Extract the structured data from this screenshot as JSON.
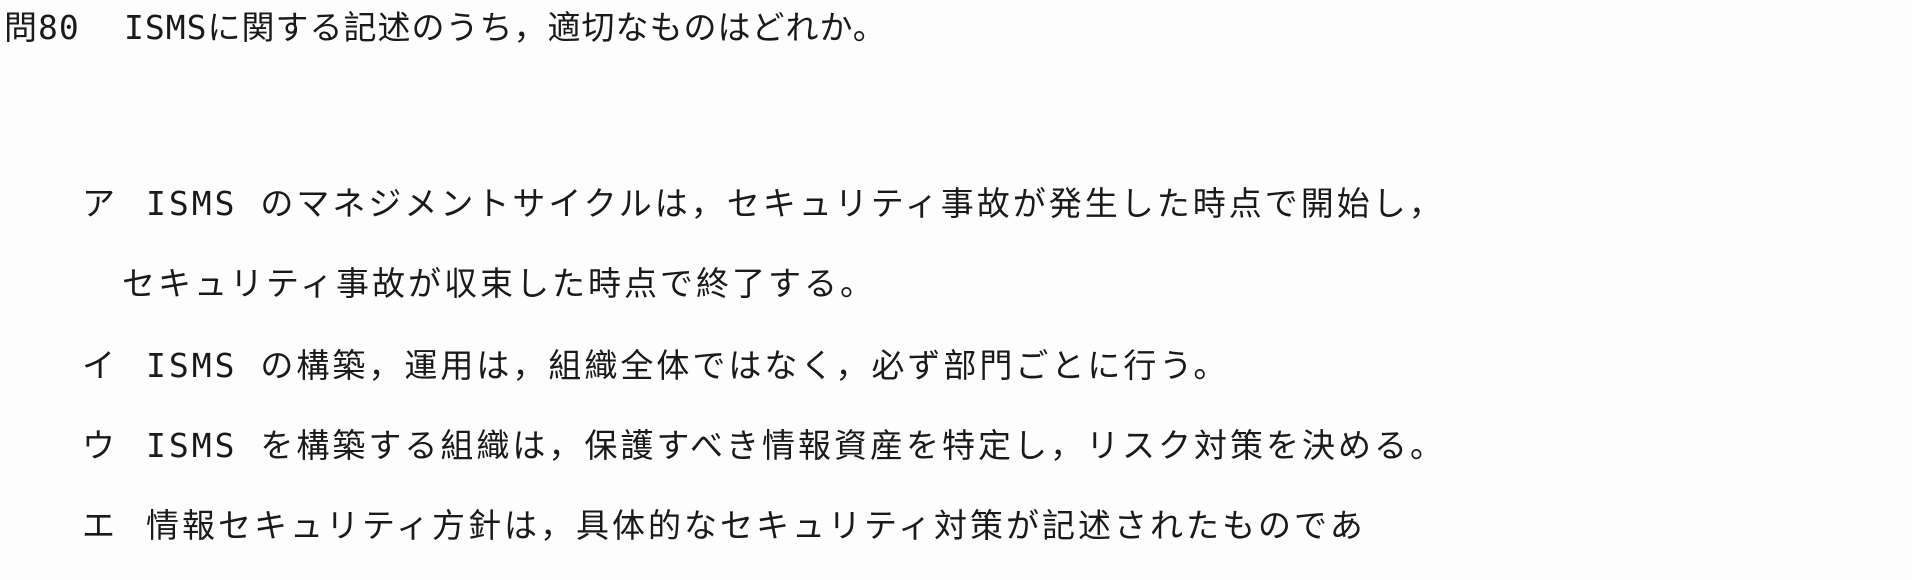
{
  "question": {
    "number": "問80",
    "text": "ISMSに関する記述のうち，適切なものはどれか。"
  },
  "choices": [
    {
      "marker": "ア",
      "lines": [
        "ISMS のマネジメントサイクルは，セキュリティ事故が発生した時点で開始し，",
        "セキュリティ事故が収束した時点で終了する。"
      ]
    },
    {
      "marker": "イ",
      "lines": [
        "ISMS の構築，運用は，組織全体ではなく，必ず部門ごとに行う。"
      ]
    },
    {
      "marker": "ウ",
      "lines": [
        "ISMS を構築する組織は，保護すべき情報資産を特定し，リスク対策を決める。"
      ]
    },
    {
      "marker": "エ",
      "lines": [
        "情報セキュリティ方針は，具体的なセキュリティ対策が記述されたものであ"
      ]
    }
  ]
}
